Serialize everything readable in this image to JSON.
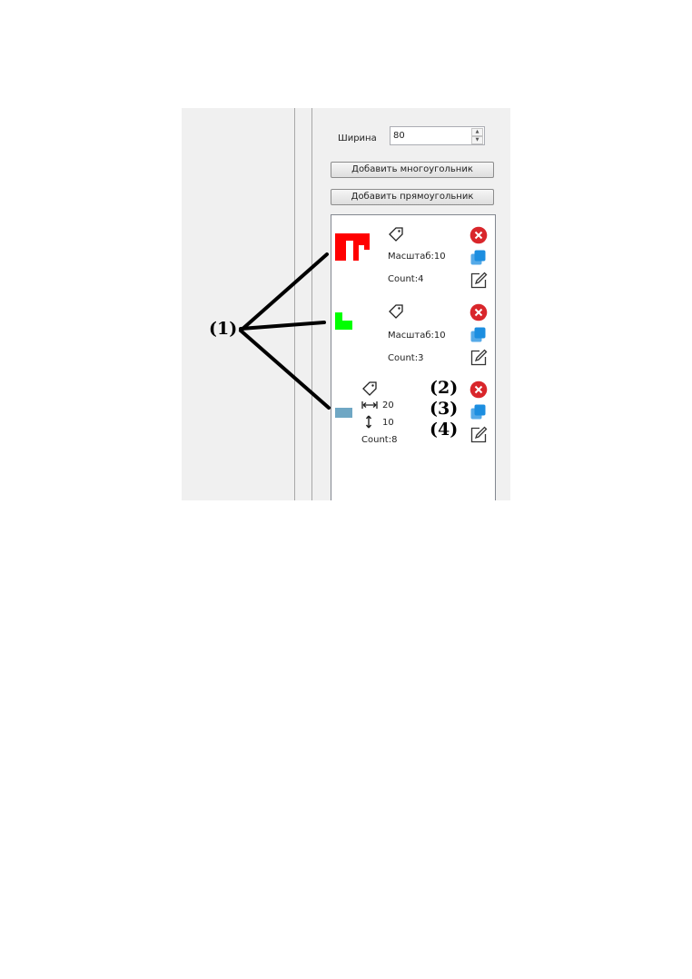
{
  "settings": {
    "width_label": "Ширина",
    "width_value": "80"
  },
  "buttons": {
    "add_polygon": "Добавить многоугольник",
    "add_rectangle": "Добавить прямоугольник"
  },
  "items": [
    {
      "scale": "Масштаб:10",
      "count": "Count:4",
      "color": "#ff0000"
    },
    {
      "scale": "Масштаб:10",
      "count": "Count:3",
      "color": "#00ff00"
    },
    {
      "width": "20",
      "height": "10",
      "count": "Count:8",
      "color": "#6fa7c4"
    }
  ],
  "annotations": {
    "shapes": "(1)",
    "delete": "(2)",
    "copy": "(3)",
    "edit": "(4)"
  },
  "colors": {
    "delete": "#d9262b",
    "copy": "#1c8ee0"
  }
}
